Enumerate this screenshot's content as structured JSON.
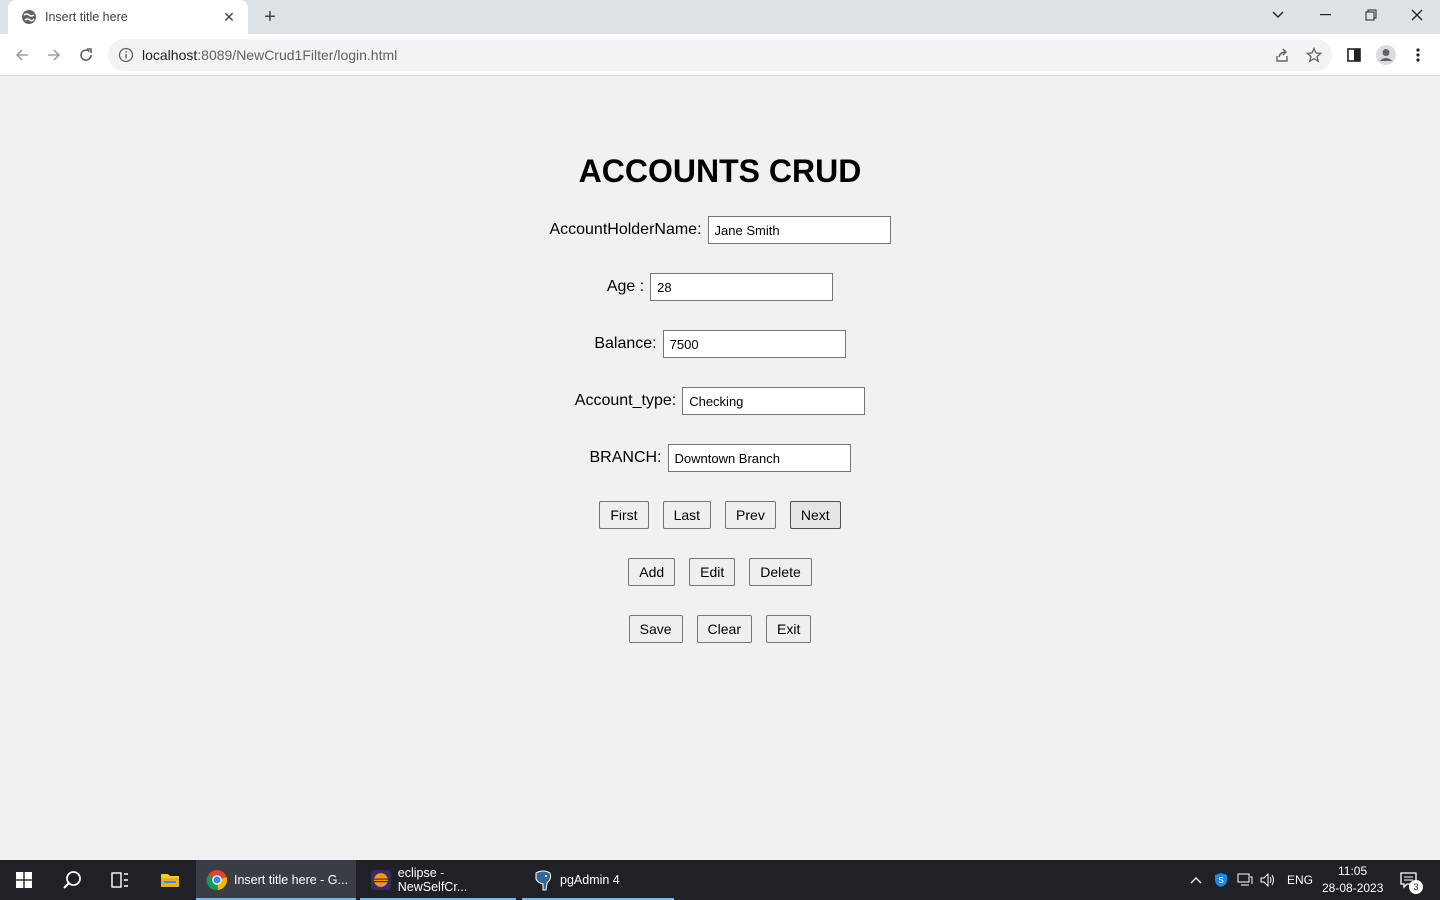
{
  "browser": {
    "tab_title": "Insert title here",
    "url_host": "localhost",
    "url_path": ":8089/NewCrud1Filter/login.html"
  },
  "page": {
    "heading": "ACCOUNTS CRUD",
    "fields": [
      {
        "label": "AccountHolderName:",
        "value": "Jane Smith"
      },
      {
        "label": "Age :",
        "value": "28"
      },
      {
        "label": "Balance:",
        "value": "7500"
      },
      {
        "label": "Account_type:",
        "value": "Checking"
      },
      {
        "label": "BRANCH:",
        "value": "Downtown Branch"
      }
    ],
    "nav_buttons": [
      "First",
      "Last",
      "Prev",
      "Next"
    ],
    "edit_buttons": [
      "Add",
      "Edit",
      "Delete"
    ],
    "action_buttons": [
      "Save",
      "Clear",
      "Exit"
    ]
  },
  "taskbar": {
    "tasks": [
      {
        "label": "Insert title here - G..."
      },
      {
        "label": "eclipse - NewSelfCr..."
      },
      {
        "label": "pgAdmin 4"
      }
    ],
    "language": "ENG",
    "time": "11:05",
    "date": "28-08-2023",
    "notification_count": "3"
  },
  "colors": {
    "accent_underline": "#76b9ed",
    "page_background": "#f1f1f1"
  }
}
